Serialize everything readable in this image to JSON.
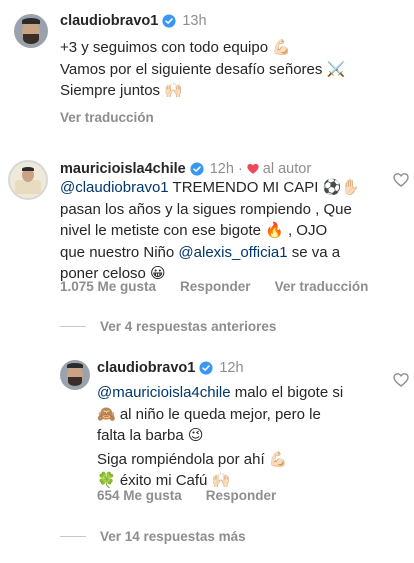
{
  "comment1": {
    "username": "claudiobravo1",
    "time": "13h",
    "lines": [
      "+3 y seguimos con todo equipo 💪🏻",
      "Vamos por el siguiente desafío señores ⚔️",
      "Siempre juntos 🙌🏻"
    ],
    "translate": "Ver traducción"
  },
  "comment2": {
    "username": "mauricioisla4chile",
    "time": "12h",
    "by_author_label": "al autor",
    "mention1": "@claudiobravo1",
    "text_a": " TREMENDO MI CAPI ⚽️✋🏻",
    "text_b": "pasan los años y la sigues rompiendo , Que",
    "text_c": "nivel le metiste con ese bigote 🔥 , OJO",
    "text_d_pre": "que nuestro Niño ",
    "mention2": "@alexis_officia1",
    "text_d_post": " se va a",
    "text_e": "poner celoso 😀",
    "likes": "1.075 Me gusta",
    "reply": "Responder",
    "translate": "Ver traducción"
  },
  "prev_replies": "Ver 4 respuestas anteriores",
  "reply1": {
    "username": "claudiobravo1",
    "time": "12h",
    "mention": "@mauricioisla4chile",
    "text_a": " malo el bigote si",
    "text_b": "🙈 al niño le queda mejor, pero le",
    "text_c": "falta la barba 😉",
    "text_d": "Siga rompiéndola por ahí 💪🏻",
    "text_e": "🍀 éxito mi Cafú 🙌🏻",
    "likes": "654 Me gusta",
    "reply": "Responder"
  },
  "more_replies": "Ver 14 respuestas más",
  "colors": {
    "mention": "#00376b",
    "verified": "#3897f0",
    "heart": "#ed4956",
    "muted": "#8e8e8e"
  }
}
